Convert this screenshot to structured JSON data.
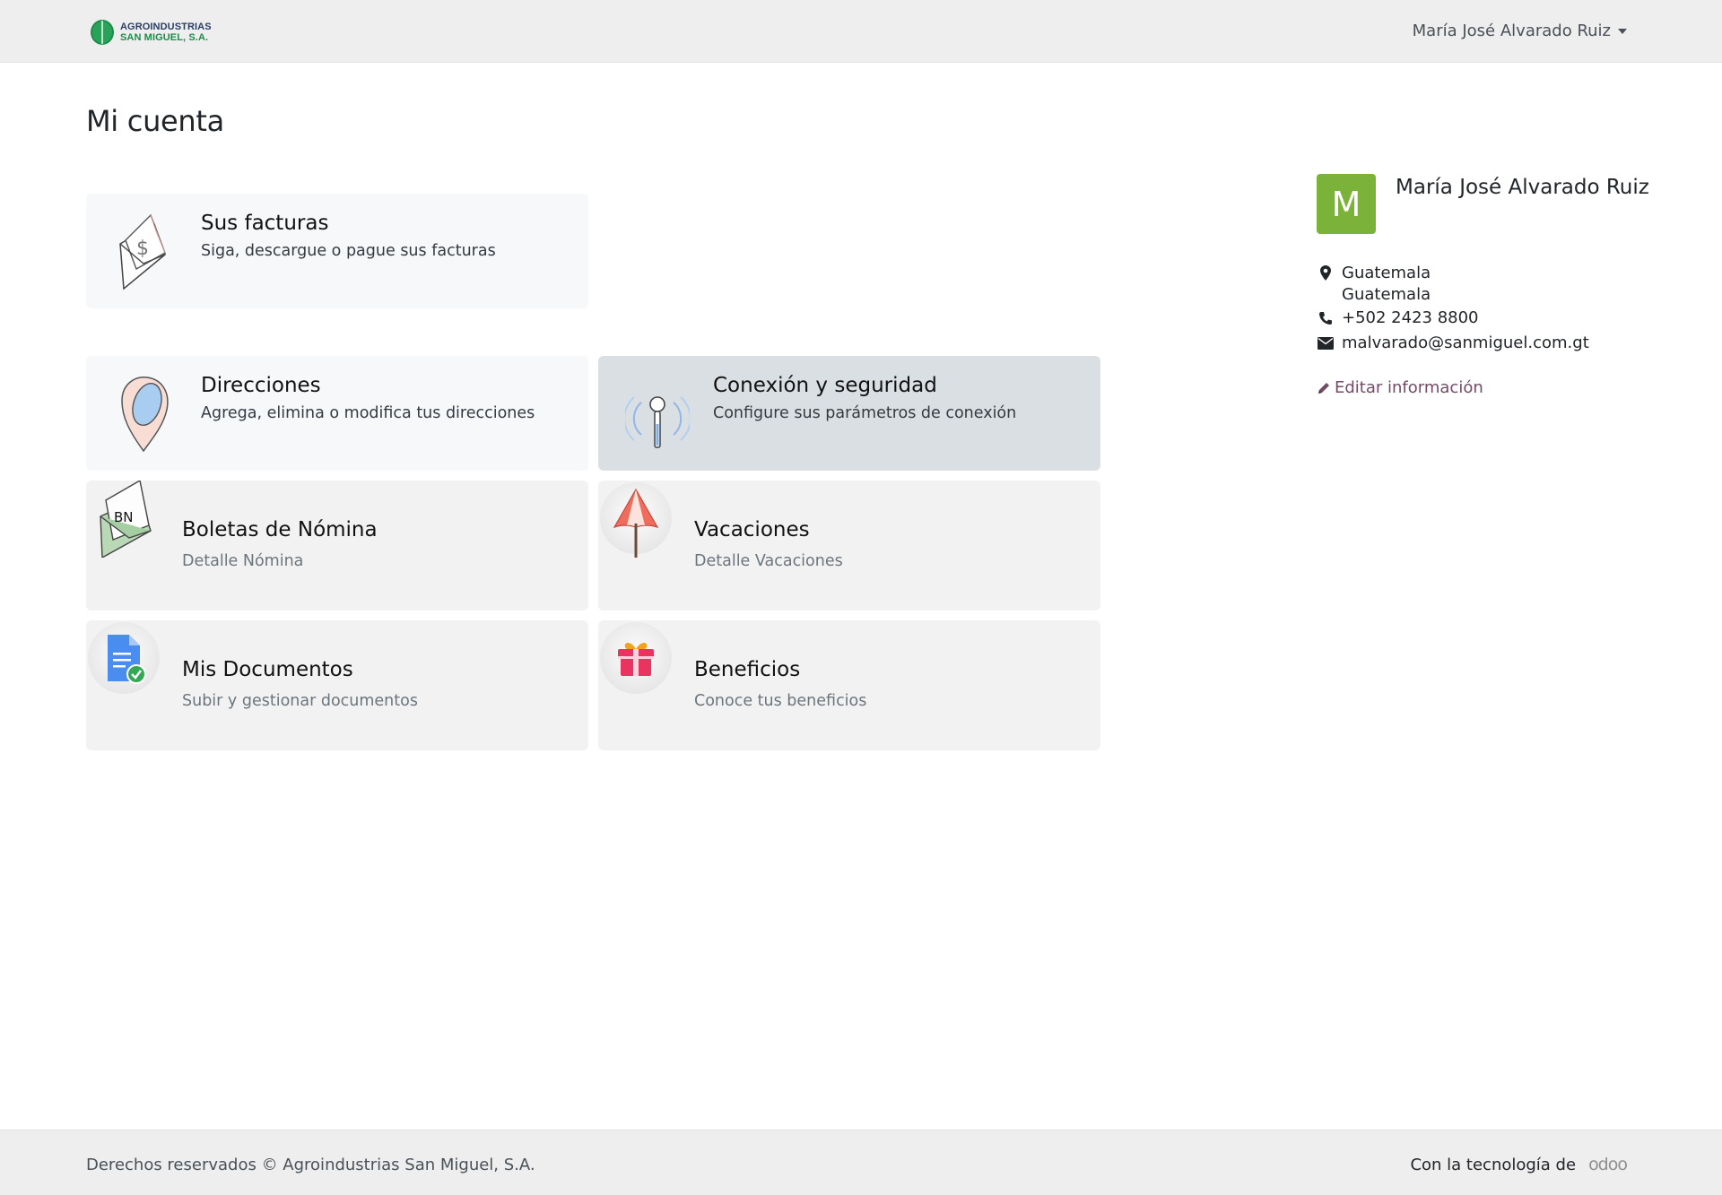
{
  "header": {
    "brand_line1": "AGROINDUSTRIAS",
    "brand_line2": "SAN MIGUEL, S.A.",
    "user_name": "María José Alvarado Ruiz",
    "icons": [
      "leaf-logo-icon",
      "caret-down-icon"
    ],
    "colors": {
      "brand_green": "#1d8c4a",
      "brand_navy": "#2a3e66"
    }
  },
  "page": {
    "title": "Mi cuenta"
  },
  "cards": [
    {
      "title": "Sus facturas",
      "subtitle": "Siga, descargue o pague sus facturas",
      "icon": "invoice-envelope-icon"
    },
    {
      "title": "Direcciones",
      "subtitle": "Agrega, elimina o modifica tus direcciones",
      "icon": "map-pin-icon"
    },
    {
      "title": "Conexión y seguridad",
      "subtitle": "Configure sus parámetros de conexión",
      "icon": "antenna-security-icon"
    },
    {
      "title": "Boletas de Nómina",
      "subtitle": "Detalle Nómina",
      "icon": "payslip-envelope-icon",
      "badge": "BN"
    },
    {
      "title": "Vacaciones",
      "subtitle": "Detalle Vacaciones",
      "icon": "beach-umbrella-icon"
    },
    {
      "title": "Mis Documentos",
      "subtitle": "Subir y gestionar documentos",
      "icon": "document-check-icon"
    },
    {
      "title": "Beneficios",
      "subtitle": "Conoce tus beneficios",
      "icon": "gift-icon"
    }
  ],
  "profile": {
    "avatar_letter": "M",
    "name": "María José Alvarado Ruiz",
    "address_line1": "Guatemala",
    "address_line2": "Guatemala",
    "phone": "+502 2423 8800",
    "email": "malvarado@sanmiguel.com.gt",
    "edit_label": "Editar información",
    "colors": {
      "avatar_bg": "#7bb33a",
      "link": "#714b67"
    },
    "icons": [
      "map-marker-icon",
      "phone-icon",
      "envelope-icon",
      "pencil-icon"
    ]
  },
  "footer": {
    "copyright": "Derechos reservados © Agroindustrias San Miguel, S.A.",
    "powered_by": "Con la tecnología de",
    "odoo": "odoo"
  }
}
